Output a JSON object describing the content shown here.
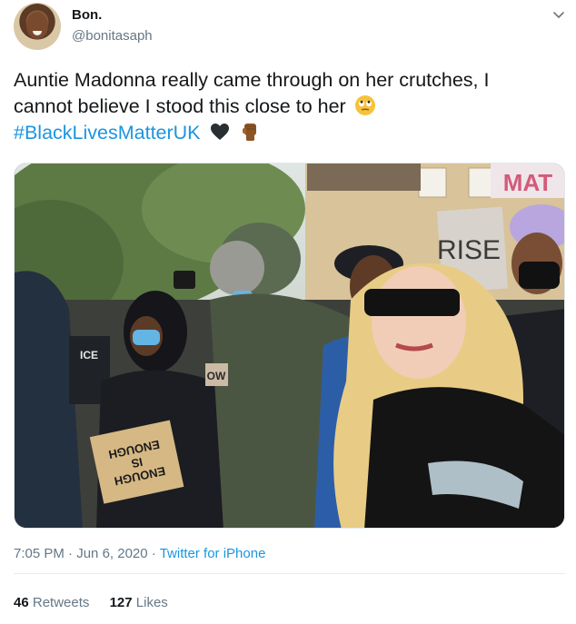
{
  "author": {
    "display_name": "Bon.",
    "handle": "@bonitasaph"
  },
  "tweet": {
    "line1": "Auntie Madonna really came through on her crutches, I",
    "line2": "cannot believe I stood this close to her",
    "hashtag": "#BlackLivesMatterUK",
    "emojis": [
      "rolling-eyes-emoji",
      "black-heart-emoji",
      "raised-fist-emoji"
    ]
  },
  "media": {
    "signs": [
      "MAT",
      "RISE",
      "ICE",
      "ENOUGH IS ENOUGH",
      "OW"
    ]
  },
  "meta": {
    "time": "7:05 PM",
    "separator": " · ",
    "date": "Jun 6, 2020",
    "source": "Twitter for iPhone"
  },
  "stats": {
    "retweets_count": "46",
    "retweets_label": "Retweets",
    "likes_count": "127",
    "likes_label": "Likes"
  },
  "colors": {
    "link": "#1b95e0",
    "muted": "#657786",
    "text": "#14171a"
  }
}
